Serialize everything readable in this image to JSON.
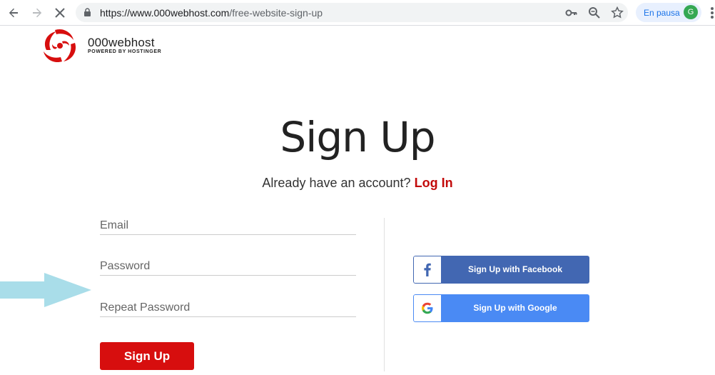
{
  "browser": {
    "url_host": "https://www.000webhost.com",
    "url_path": "/free-website-sign-up",
    "profile_label": "En pausa",
    "profile_initial": "G"
  },
  "logo": {
    "name": "000webhost",
    "tagline": "POWERED BY HOSTINGER"
  },
  "page": {
    "title": "Sign Up",
    "account_prompt": "Already have an account?",
    "login_link": "Log In"
  },
  "form": {
    "email_placeholder": "Email",
    "password_placeholder": "Password",
    "repeat_password_placeholder": "Repeat Password",
    "submit_label": "Sign Up"
  },
  "social": {
    "facebook_label": "Sign Up with Facebook",
    "google_label": "Sign Up with Google"
  },
  "colors": {
    "brand_red": "#d70e0e",
    "facebook_blue": "#4267b2",
    "google_blue": "#4a8af4",
    "annotation_arrow": "#a9dde9"
  }
}
